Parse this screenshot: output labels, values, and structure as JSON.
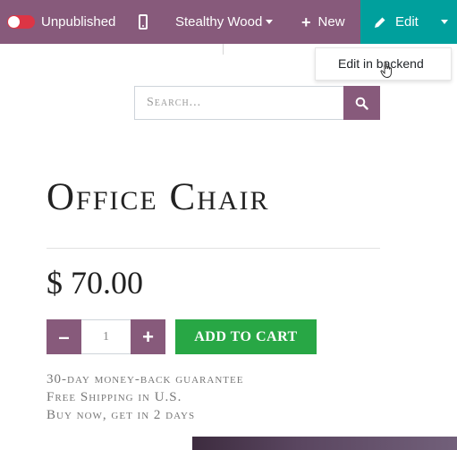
{
  "topbar": {
    "publish_label": "Unpublished",
    "theme_label": "Stealthy Wood",
    "new_label": "New",
    "edit_label": "Edit"
  },
  "edit_dropdown": {
    "item_label": "Edit in backend"
  },
  "search": {
    "placeholder": "Search..."
  },
  "product": {
    "title": "Office Chair",
    "price": "$ 70.00",
    "quantity": "1",
    "add_to_cart_label": "ADD TO CART",
    "info": [
      "30-day money-back guarantee",
      "Free Shipping in U.S.",
      "Buy now, get in 2 days"
    ]
  },
  "colors": {
    "brand": "#875a7b",
    "edit_accent": "#00a09d",
    "cart_green": "#28a745",
    "unpublished_red": "#dc3545"
  },
  "icons": [
    "phone-icon",
    "plus-icon",
    "pencil-icon",
    "chevron-down-icon",
    "search-icon",
    "minus-icon",
    "hand-cursor-icon"
  ]
}
